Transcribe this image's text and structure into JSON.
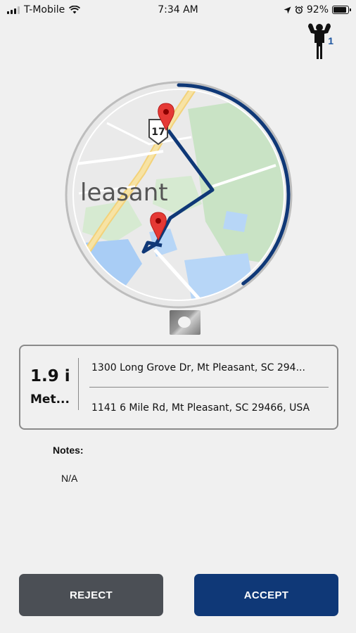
{
  "status_bar": {
    "carrier": "T-Mobile",
    "time": "7:34 AM",
    "battery_percent": "92%",
    "battery_level": 0.92
  },
  "header": {
    "badge_count": "1",
    "icon": "strongman-icon"
  },
  "map": {
    "town_label": "leasant",
    "route_shield": "17",
    "progress_ring_fraction": 0.4,
    "route_color": "#0f3877"
  },
  "trip": {
    "distance": "1.9 i",
    "unit": "Met...",
    "pickup_address": "1300 Long Grove Dr, Mt Pleasant, SC 294...",
    "dropoff_address": "1141 6 Mile Rd, Mt Pleasant, SC 29466, USA"
  },
  "notes": {
    "label": "Notes:",
    "value": "N/A"
  },
  "actions": {
    "reject_label": "REJECT",
    "accept_label": "ACCEPT"
  },
  "colors": {
    "accept": "#0f3877",
    "reject": "#4b4f55",
    "badge": "#1e56a0"
  }
}
